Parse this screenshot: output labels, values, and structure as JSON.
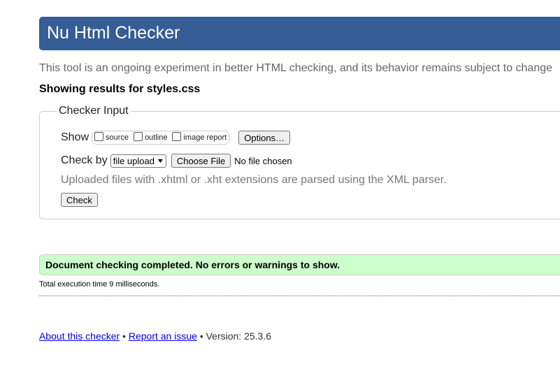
{
  "header": {
    "title": "Nu Html Checker"
  },
  "intro": "This tool is an ongoing experiment in better HTML checking, and its behavior remains subject to change",
  "results_heading": "Showing results for styles.css",
  "checker_input": {
    "legend": "Checker Input",
    "show_label": "Show",
    "show_options": [
      {
        "label": "source",
        "checked": false
      },
      {
        "label": "outline",
        "checked": false
      },
      {
        "label": "image report",
        "checked": false
      }
    ],
    "options_button": "Options…",
    "check_by_label": "Check by",
    "check_by_selected": "file upload",
    "choose_file_button": "Choose File",
    "no_file_text": "No file chosen",
    "upload_note": "Uploaded files with .xhtml or .xht extensions are parsed using the XML parser.",
    "check_button": "Check"
  },
  "result": {
    "success_message": "Document checking completed. No errors or warnings to show.",
    "exec_time": "Total execution time 9 milliseconds."
  },
  "footer": {
    "about_link": "About this checker",
    "separator": "•",
    "report_link": "Report an issue",
    "version_text": "Version: 25.3.6"
  },
  "colors": {
    "header_bg": "#365d95",
    "success_bg": "#ccffcc",
    "link": "#0000ee"
  },
  "icons": {
    "select_chevron": "chevron-down-icon"
  }
}
